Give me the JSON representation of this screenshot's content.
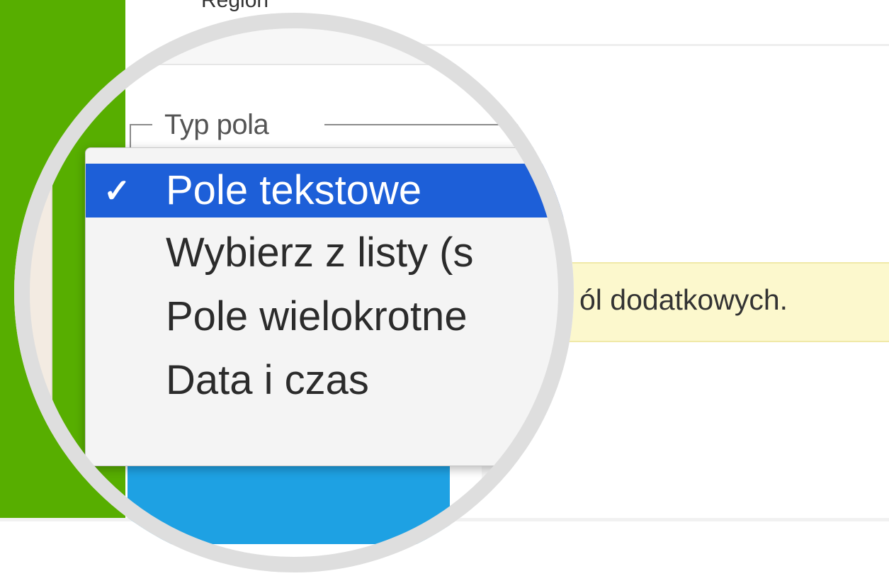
{
  "form": {
    "region_label": "Region",
    "fieldset_legend": "Typ pola",
    "notice_text": "ól dodatkowych."
  },
  "dropdown": {
    "selected_index": 0,
    "options": [
      {
        "label": "Pole tekstowe",
        "selected": true,
        "check": "✓"
      },
      {
        "label": "Wybierz z listy (s",
        "selected": false
      },
      {
        "label": "Pole wielokrotne",
        "selected": false
      },
      {
        "label": "Data i czas",
        "selected": false
      }
    ]
  },
  "colors": {
    "sidebar_green": "#57ae00",
    "selection_blue": "#1d5fd8",
    "button_blue": "#1ea1e3",
    "notice_yellow": "#fcf8cd"
  }
}
